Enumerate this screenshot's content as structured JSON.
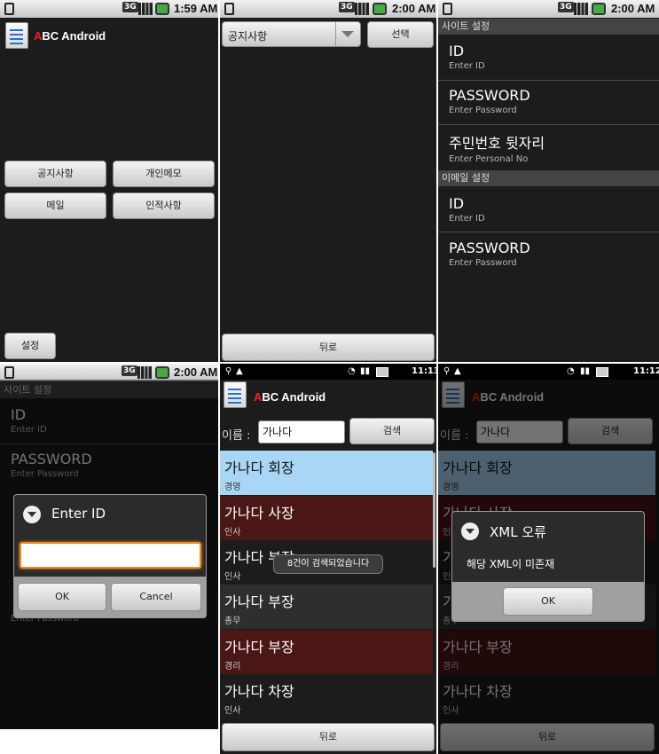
{
  "app": {
    "name_first_letter": "A",
    "name_rest": "BC Android"
  },
  "statusbar": {
    "t1": "1:59 AM",
    "t2": "2:00 AM",
    "t3": "2:00 AM",
    "t4": "2:00 AM",
    "t5": "11:13",
    "t6": "11:12",
    "net": "3G"
  },
  "menu": {
    "notice": "공지사항",
    "memo": "개인메모",
    "mail": "메일",
    "hr": "인적사항",
    "settings": "설정"
  },
  "select_screen": {
    "selected": "공지사항",
    "select_button": "선택",
    "back_button": "뒤로"
  },
  "prefs": {
    "site_header": "사이트 설정",
    "mail_header": "이메일 설정",
    "id": "ID",
    "enter_id": "Enter ID",
    "password": "PASSWORD",
    "enter_password": "Enter Password",
    "resident": "주민번호 뒷자리",
    "enter_personal": "Enter Personal No"
  },
  "id_dialog": {
    "title": "Enter ID",
    "value": "",
    "ok": "OK",
    "cancel": "Cancel"
  },
  "search": {
    "label": "이름 :",
    "value": "가나다",
    "button": "검색",
    "back": "뒤로"
  },
  "results": [
    {
      "name": "가나다 회장",
      "dept": "경영"
    },
    {
      "name": "가나다 사장",
      "dept": "인사"
    },
    {
      "name": "가나다 부장",
      "dept": "인사"
    },
    {
      "name": "가나다 부장",
      "dept": "총무"
    },
    {
      "name": "가나다 부장",
      "dept": "경리"
    },
    {
      "name": "가나다 차장",
      "dept": "인사"
    }
  ],
  "toast": "8건이 검색되었습니다",
  "xml_error": {
    "title": "XML 오류",
    "message": "해당 XML이 미존재",
    "ok": "OK"
  },
  "colors": {
    "selected_row": "#a9d6f5",
    "alt_row": "#4a1616",
    "accent": "#e22222",
    "focus": "#f08a1c"
  }
}
